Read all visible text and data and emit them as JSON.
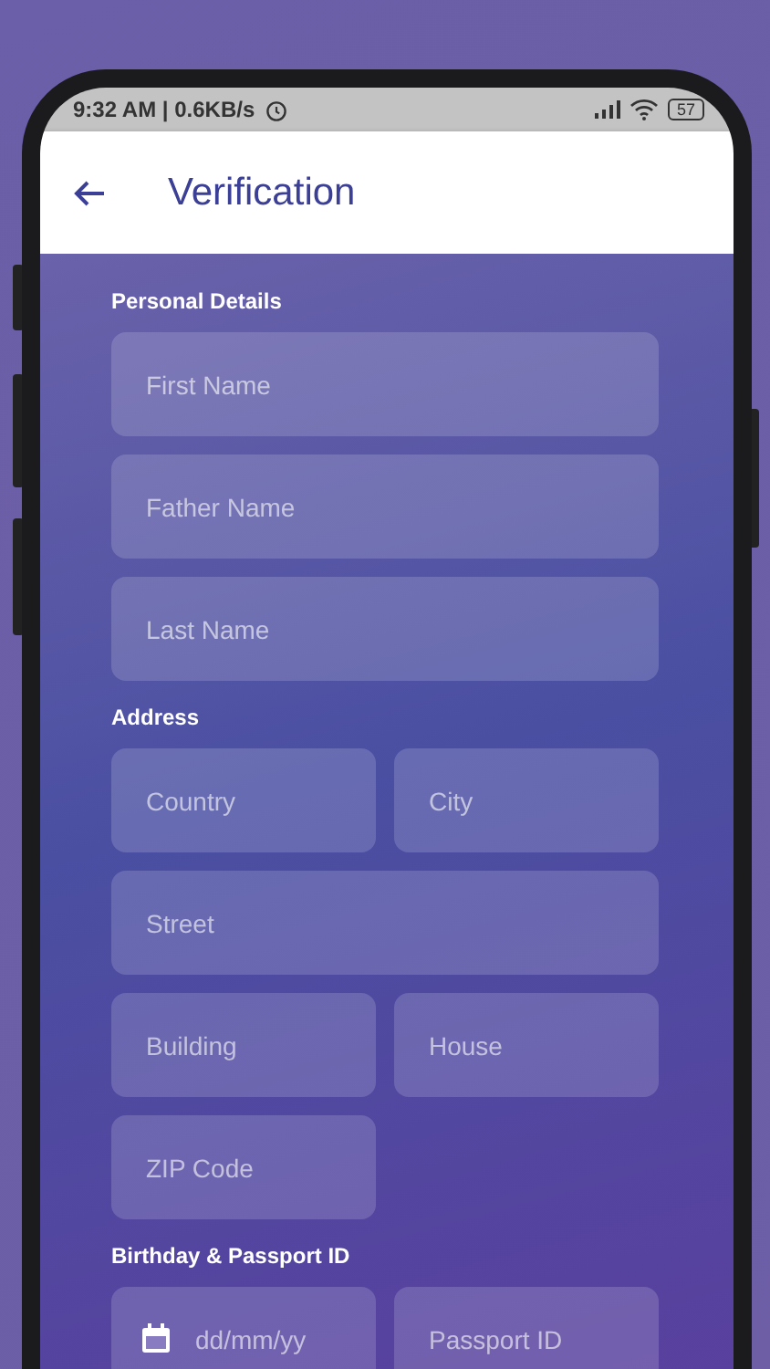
{
  "status_bar": {
    "time": "9:32 AM | 0.6KB/s",
    "battery": "57"
  },
  "header": {
    "title": "Verification"
  },
  "sections": [
    {
      "title": "Personal Details",
      "fields": [
        {
          "placeholder": "First Name",
          "kind": "text",
          "wide": true
        },
        {
          "placeholder": "Father Name",
          "kind": "text",
          "wide": true
        },
        {
          "placeholder": "Last Name",
          "kind": "text",
          "wide": true
        }
      ]
    },
    {
      "title": "Address",
      "fields": [
        {
          "placeholder": "Country",
          "kind": "text",
          "wide": false
        },
        {
          "placeholder": "City",
          "kind": "text",
          "wide": false
        },
        {
          "placeholder": "Street",
          "kind": "text",
          "wide": true
        },
        {
          "placeholder": "Building",
          "kind": "text",
          "wide": false
        },
        {
          "placeholder": "House",
          "kind": "text",
          "wide": false
        },
        {
          "placeholder": "ZIP Code",
          "kind": "text",
          "wide": false
        }
      ]
    },
    {
      "title": "Birthday & Passport ID",
      "fields": [
        {
          "placeholder": "dd/mm/yy",
          "kind": "date",
          "wide": false
        },
        {
          "placeholder": "Passport ID",
          "kind": "text",
          "wide": false
        }
      ]
    }
  ]
}
